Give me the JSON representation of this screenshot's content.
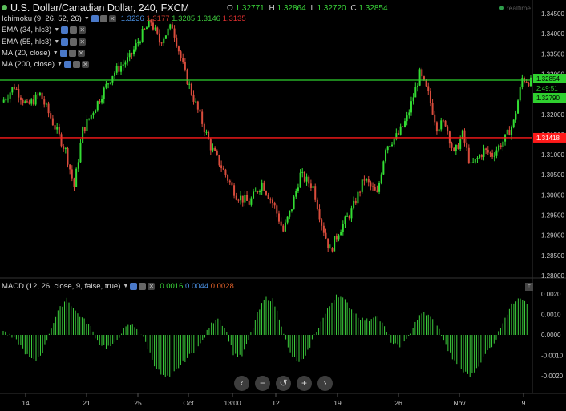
{
  "header": {
    "symbol_title": "U.S. Dollar/Canadian Dollar, 240, FXCM",
    "ohlc": {
      "o_label": "O",
      "o": "1.32771",
      "h_label": "H",
      "h": "1.32864",
      "l_label": "L",
      "l": "1.32720",
      "c_label": "C",
      "c": "1.32854"
    },
    "realtime": "realtime"
  },
  "indicators": [
    {
      "label": "Ichimoku (9, 26, 52, 26)",
      "values": [
        {
          "text": "1.3236",
          "color": "#4a8fe0"
        },
        {
          "text": "1.3177",
          "color": "#c0392b"
        },
        {
          "text": "1.3285",
          "color": "#3cc43c"
        },
        {
          "text": "1.3146",
          "color": "#3cc43c"
        },
        {
          "text": "1.3135",
          "color": "#e03030"
        }
      ]
    },
    {
      "label": "EMA (34, hlc3)",
      "values": []
    },
    {
      "label": "EMA (55, hlc3)",
      "values": []
    },
    {
      "label": "MA (20, close)",
      "values": []
    },
    {
      "label": "MA (200, close)",
      "values": []
    }
  ],
  "macd": {
    "label": "MACD (12, 26, close, 9, false, true)",
    "values": [
      {
        "text": "0.0016",
        "color": "#39d539"
      },
      {
        "text": "0.0044",
        "color": "#4a8fe0"
      },
      {
        "text": "0.0028",
        "color": "#e0602a"
      }
    ]
  },
  "navigation": {
    "left": "‹",
    "zoom_out": "−",
    "reset": "↺",
    "zoom_in": "+",
    "right": "›"
  },
  "colors": {
    "up": "#33dd33",
    "down": "#d94c3c",
    "wick_up": "#33dd33",
    "wick_down": "#d94c3c",
    "green_line": "#2fd12f",
    "red_line": "#ff1a1a",
    "grid": "#1a1a1a",
    "axis_text": "#c8c8c8"
  },
  "chart_data": {
    "type": "candlestick",
    "price_axis": {
      "ticks": [
        "1.34500",
        "1.34000",
        "1.33500",
        "1.33000",
        "1.32500",
        "1.32000",
        "1.31500",
        "1.31000",
        "1.30500",
        "1.30000",
        "1.29500",
        "1.29000",
        "1.28500",
        "1.28000"
      ],
      "min": 1.28,
      "max": 1.345
    },
    "price_labels": {
      "green": "1.32854",
      "countdown": "2:49:51",
      "green2": "1.32790",
      "red": "1.31418"
    },
    "horizontal_lines": [
      {
        "value": 1.3285,
        "color": "green"
      },
      {
        "value": 1.3142,
        "color": "red"
      }
    ],
    "x_ticks": [
      "14",
      "21",
      "25",
      "Oct",
      "13:00",
      "12",
      "19",
      "26",
      "Nov",
      "9"
    ],
    "series_path": [
      [
        0,
        1.323
      ],
      [
        6,
        1.327
      ],
      [
        12,
        1.322
      ],
      [
        18,
        1.325
      ],
      [
        24,
        1.318
      ],
      [
        30,
        1.311
      ],
      [
        34,
        1.302
      ],
      [
        38,
        1.316
      ],
      [
        44,
        1.322
      ],
      [
        52,
        1.33
      ],
      [
        60,
        1.334
      ],
      [
        66,
        1.34
      ],
      [
        70,
        1.343
      ],
      [
        74,
        1.338
      ],
      [
        80,
        1.342
      ],
      [
        86,
        1.33
      ],
      [
        92,
        1.321
      ],
      [
        98,
        1.312
      ],
      [
        104,
        1.306
      ],
      [
        110,
        1.3
      ],
      [
        116,
        1.298
      ],
      [
        122,
        1.303
      ],
      [
        128,
        1.297
      ],
      [
        132,
        1.291
      ],
      [
        136,
        1.297
      ],
      [
        140,
        1.305
      ],
      [
        146,
        1.302
      ],
      [
        150,
        1.293
      ],
      [
        154,
        1.286
      ],
      [
        158,
        1.291
      ],
      [
        164,
        1.296
      ],
      [
        170,
        1.304
      ],
      [
        176,
        1.3
      ],
      [
        180,
        1.312
      ],
      [
        186,
        1.315
      ],
      [
        190,
        1.319
      ],
      [
        196,
        1.33
      ],
      [
        200,
        1.325
      ],
      [
        204,
        1.317
      ],
      [
        208,
        1.318
      ],
      [
        212,
        1.31
      ],
      [
        216,
        1.315
      ],
      [
        220,
        1.307
      ],
      [
        226,
        1.311
      ],
      [
        230,
        1.31
      ],
      [
        236,
        1.314
      ],
      [
        240,
        1.318
      ],
      [
        244,
        1.329
      ],
      [
        248,
        1.328
      ]
    ],
    "macd_axis": {
      "ticks": [
        "0.0020",
        "0.0010",
        "0.0000",
        "-0.0010",
        "-0.0020"
      ],
      "min": -0.0025,
      "max": 0.0025
    },
    "macd_hist": [
      0.0002,
      -0.0001,
      -0.0004,
      -0.001,
      -0.0013,
      -0.0008,
      0.0003,
      0.0012,
      0.0018,
      0.0012,
      0.0008,
      0.0004,
      -0.0004,
      -0.0006,
      -0.0005,
      0.0002,
      0.0005,
      0.0003,
      -0.0004,
      -0.0014,
      -0.002,
      -0.0021,
      -0.0016,
      -0.0012,
      -0.0008,
      -0.0004,
      0.0004,
      0.0009,
      0.0003,
      -0.0009,
      -0.0011,
      -0.0002,
      0.001,
      0.0018,
      0.0017,
      0.0006,
      -0.0008,
      -0.0013,
      -0.0012,
      -0.0002,
      0.0006,
      0.0013,
      0.002,
      0.0017,
      0.0012,
      0.0008,
      0.0007,
      0.001,
      0.0004,
      -0.0004,
      -0.0006,
      -0.0002,
      0.0007,
      0.0011,
      0.0008,
      0.0002,
      -0.0007,
      -0.0014,
      -0.0018,
      -0.002,
      -0.0014,
      -0.0008,
      -0.0003,
      0.0007,
      0.0014,
      0.0019,
      0.0016
    ]
  }
}
